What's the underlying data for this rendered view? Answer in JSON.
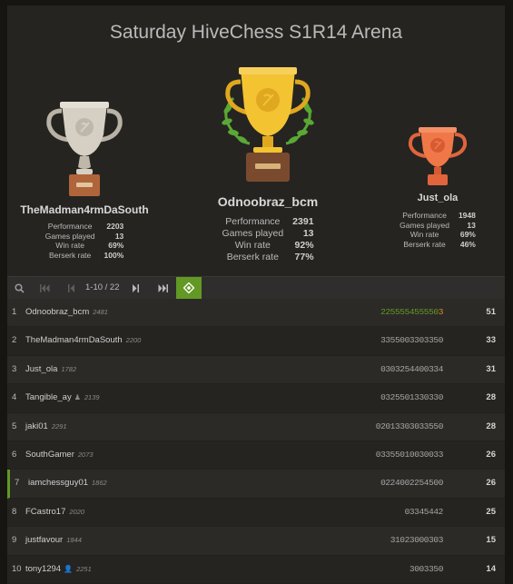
{
  "title": "Saturday HiveChess S1R14 Arena",
  "podium": {
    "first": {
      "name": "Odnoobraz_bcm",
      "stats": [
        {
          "label": "Performance",
          "value": "2391"
        },
        {
          "label": "Games played",
          "value": "13"
        },
        {
          "label": "Win rate",
          "value": "92%"
        },
        {
          "label": "Berserk rate",
          "value": "77%"
        }
      ]
    },
    "second": {
      "name": "TheMadman4rmDaSouth",
      "stats": [
        {
          "label": "Performance",
          "value": "2203"
        },
        {
          "label": "Games played",
          "value": "13"
        },
        {
          "label": "Win rate",
          "value": "69%"
        },
        {
          "label": "Berserk rate",
          "value": "100%"
        }
      ]
    },
    "third": {
      "name": "Just_ola",
      "stats": [
        {
          "label": "Performance",
          "value": "1948"
        },
        {
          "label": "Games played",
          "value": "13"
        },
        {
          "label": "Win rate",
          "value": "69%"
        },
        {
          "label": "Berserk rate",
          "value": "46%"
        }
      ]
    }
  },
  "pager": {
    "range": "1-10 / 22",
    "icons": [
      "search-icon",
      "first-page-icon",
      "prev-page-icon",
      "next-page-icon",
      "last-page-icon",
      "locate-me-icon"
    ]
  },
  "colors": {
    "fire": "#629924",
    "win": "#d59020",
    "accent_green": "#629924"
  },
  "standings": [
    {
      "rank": "1",
      "name": "Odnoobraz_bcm",
      "rating": "2481",
      "sheet": "225555455550",
      "fire_tail": "3",
      "score": "51"
    },
    {
      "rank": "2",
      "name": "TheMadman4rmDaSouth",
      "rating": "2200",
      "sheet": "3355003303350",
      "fire_tail": "",
      "score": "33"
    },
    {
      "rank": "3",
      "name": "Just_ola",
      "rating": "1782",
      "sheet": "0303254400334",
      "fire_tail": "",
      "score": "31"
    },
    {
      "rank": "4",
      "name": "Tangible_ay",
      "rating": "2139",
      "sheet": "0325501330330",
      "fire_tail": "",
      "score": "28",
      "bot": true
    },
    {
      "rank": "5",
      "name": "jaki01",
      "rating": "2291",
      "sheet": "02013303033550",
      "fire_tail": "",
      "score": "28"
    },
    {
      "rank": "6",
      "name": "SouthGamer",
      "rating": "2073",
      "sheet": "03355010030033",
      "fire_tail": "",
      "score": "26"
    },
    {
      "rank": "7",
      "name": "iamchessguy01",
      "rating": "1862",
      "sheet": "0224002254500",
      "fire_tail": "",
      "score": "26",
      "me": true
    },
    {
      "rank": "8",
      "name": "FCastro17",
      "rating": "2020",
      "sheet": "03345442",
      "fire_tail": "",
      "score": "25"
    },
    {
      "rank": "9",
      "name": "justfavour",
      "rating": "1844",
      "sheet": "31023000303",
      "fire_tail": "",
      "score": "15"
    },
    {
      "rank": "10",
      "name": "tony1294",
      "rating": "2251",
      "sheet": "3003350",
      "fire_tail": "",
      "score": "14",
      "patron": true
    }
  ]
}
